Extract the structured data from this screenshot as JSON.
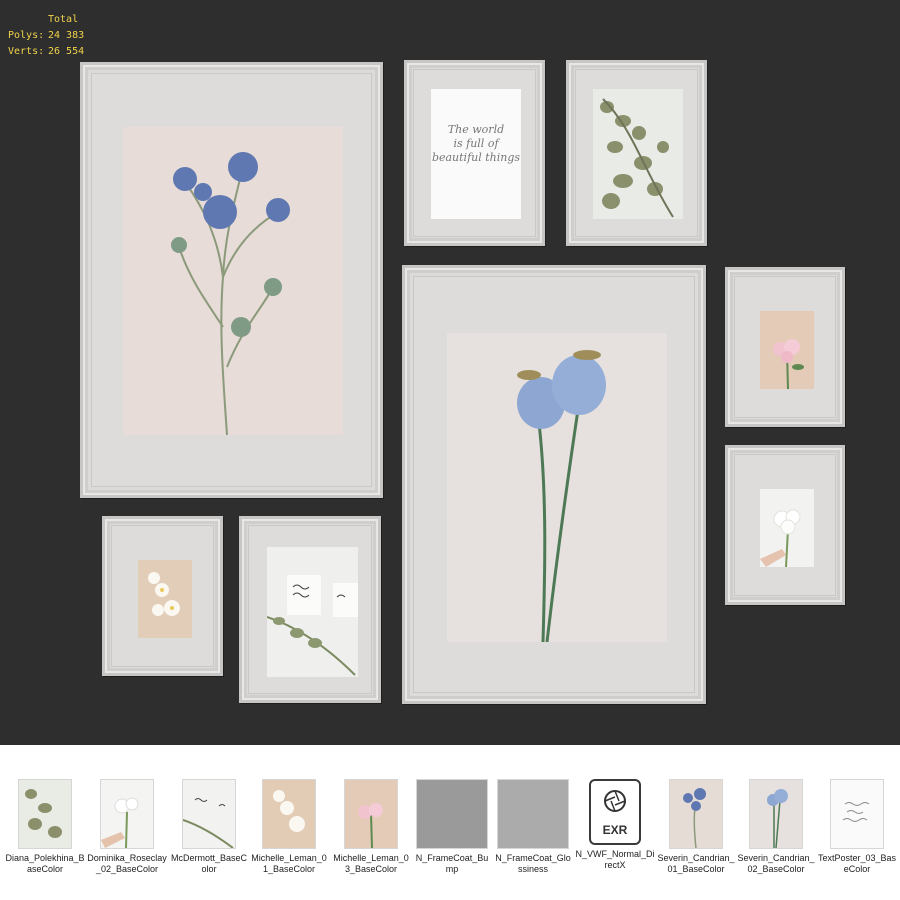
{
  "stats": {
    "header": "Total",
    "polys_label": "Polys:",
    "polys_value": "24 383",
    "verts_label": "Verts:",
    "verts_value": "26 554"
  },
  "colors": {
    "viewport_bg": "#2e2e2e",
    "stats_text": "#f0d24a",
    "frame": "#dcdbd9"
  },
  "frames": [
    {
      "id": "frame-large-thistle",
      "photo": "blue-thistle-photo"
    },
    {
      "id": "frame-quote-poster",
      "photo": "quote-poster",
      "quote": [
        "The world",
        "is full of",
        "beautiful things"
      ]
    },
    {
      "id": "frame-eucalyptus",
      "photo": "eucalyptus-photo"
    },
    {
      "id": "frame-poppy",
      "photo": "poppy-pods-photo"
    },
    {
      "id": "frame-pink-rose",
      "photo": "pink-rose-photo"
    },
    {
      "id": "frame-white-bouquet",
      "photo": "white-bouquet-photo"
    },
    {
      "id": "frame-white-daisies",
      "photo": "white-daisies-photo"
    },
    {
      "id": "frame-handwriting",
      "photo": "handwriting-photo"
    }
  ],
  "assets": [
    {
      "label": "Diana_Polekhina_BaseColor",
      "icon": "eucalyptus-thumb"
    },
    {
      "label": "Dominika_Roseclay_02_BaseColor",
      "icon": "white-bouquet-thumb"
    },
    {
      "label": "McDermott_BaseColor",
      "icon": "handwriting-thumb"
    },
    {
      "label": "Michelle_Leman_01_BaseColor",
      "icon": "daisies-thumb"
    },
    {
      "label": "Michelle_Leman_03_BaseColor",
      "icon": "pink-rose-thumb"
    },
    {
      "label": "N_FrameCoat_Bump",
      "icon": "gray-noise-thumb"
    },
    {
      "label": "N_FrameCoat_Glossiness",
      "icon": "gray-noise-thumb"
    },
    {
      "label": "N_VWF_Normal_DirectX",
      "icon": "exr-file-icon",
      "badge": "EXR"
    },
    {
      "label": "Severin_Candrian_01_BaseColor",
      "icon": "thistle-thumb"
    },
    {
      "label": "Severin_Candrian_02_BaseColor",
      "icon": "poppy-thumb"
    },
    {
      "label": "TextPoster_03_BaseColor",
      "icon": "text-poster-thumb"
    }
  ]
}
